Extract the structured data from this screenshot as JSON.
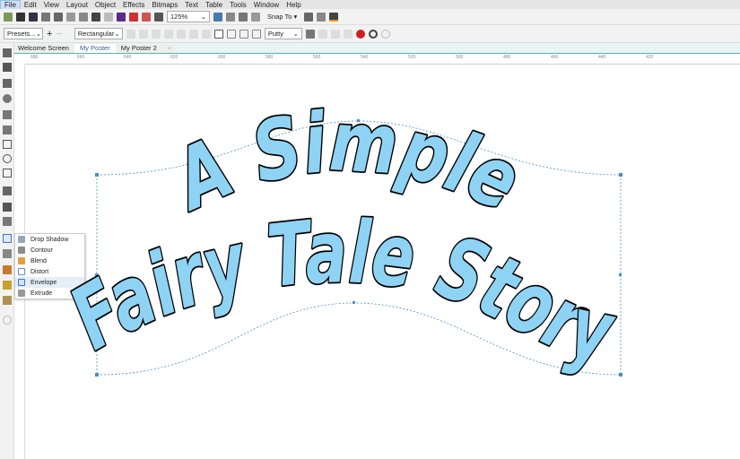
{
  "menu": [
    "File",
    "Edit",
    "View",
    "Layout",
    "Object",
    "Effects",
    "Bitmaps",
    "Text",
    "Table",
    "Tools",
    "Window",
    "Help"
  ],
  "toolbar": {
    "zoom": "125%",
    "snap": "Snap To"
  },
  "propbar": {
    "presets": "Presets...",
    "shape": "Rectangular",
    "mapping": "Putty"
  },
  "tabs": [
    "Welcome Screen",
    "My Poster",
    "My Poster 2"
  ],
  "ruler": [
    "680",
    "660",
    "640",
    "620",
    "600",
    "580",
    "560",
    "540",
    "520",
    "500",
    "480",
    "460",
    "440",
    "420"
  ],
  "flyout": [
    {
      "label": "Drop Shadow",
      "color": "#9aa6b8"
    },
    {
      "label": "Contour",
      "color": "#8c8c8c"
    },
    {
      "label": "Blend",
      "color": "#e0a040"
    },
    {
      "label": "Distort",
      "color": "#6a8cc0"
    },
    {
      "label": "Envelope",
      "color": "#3a78c8"
    },
    {
      "label": "Extrude",
      "color": "#999999"
    }
  ],
  "artwork": {
    "line1": "A Simple",
    "line2": "Fairy Tale Story",
    "fill": "#8fd3f4",
    "stroke": "#000000"
  }
}
